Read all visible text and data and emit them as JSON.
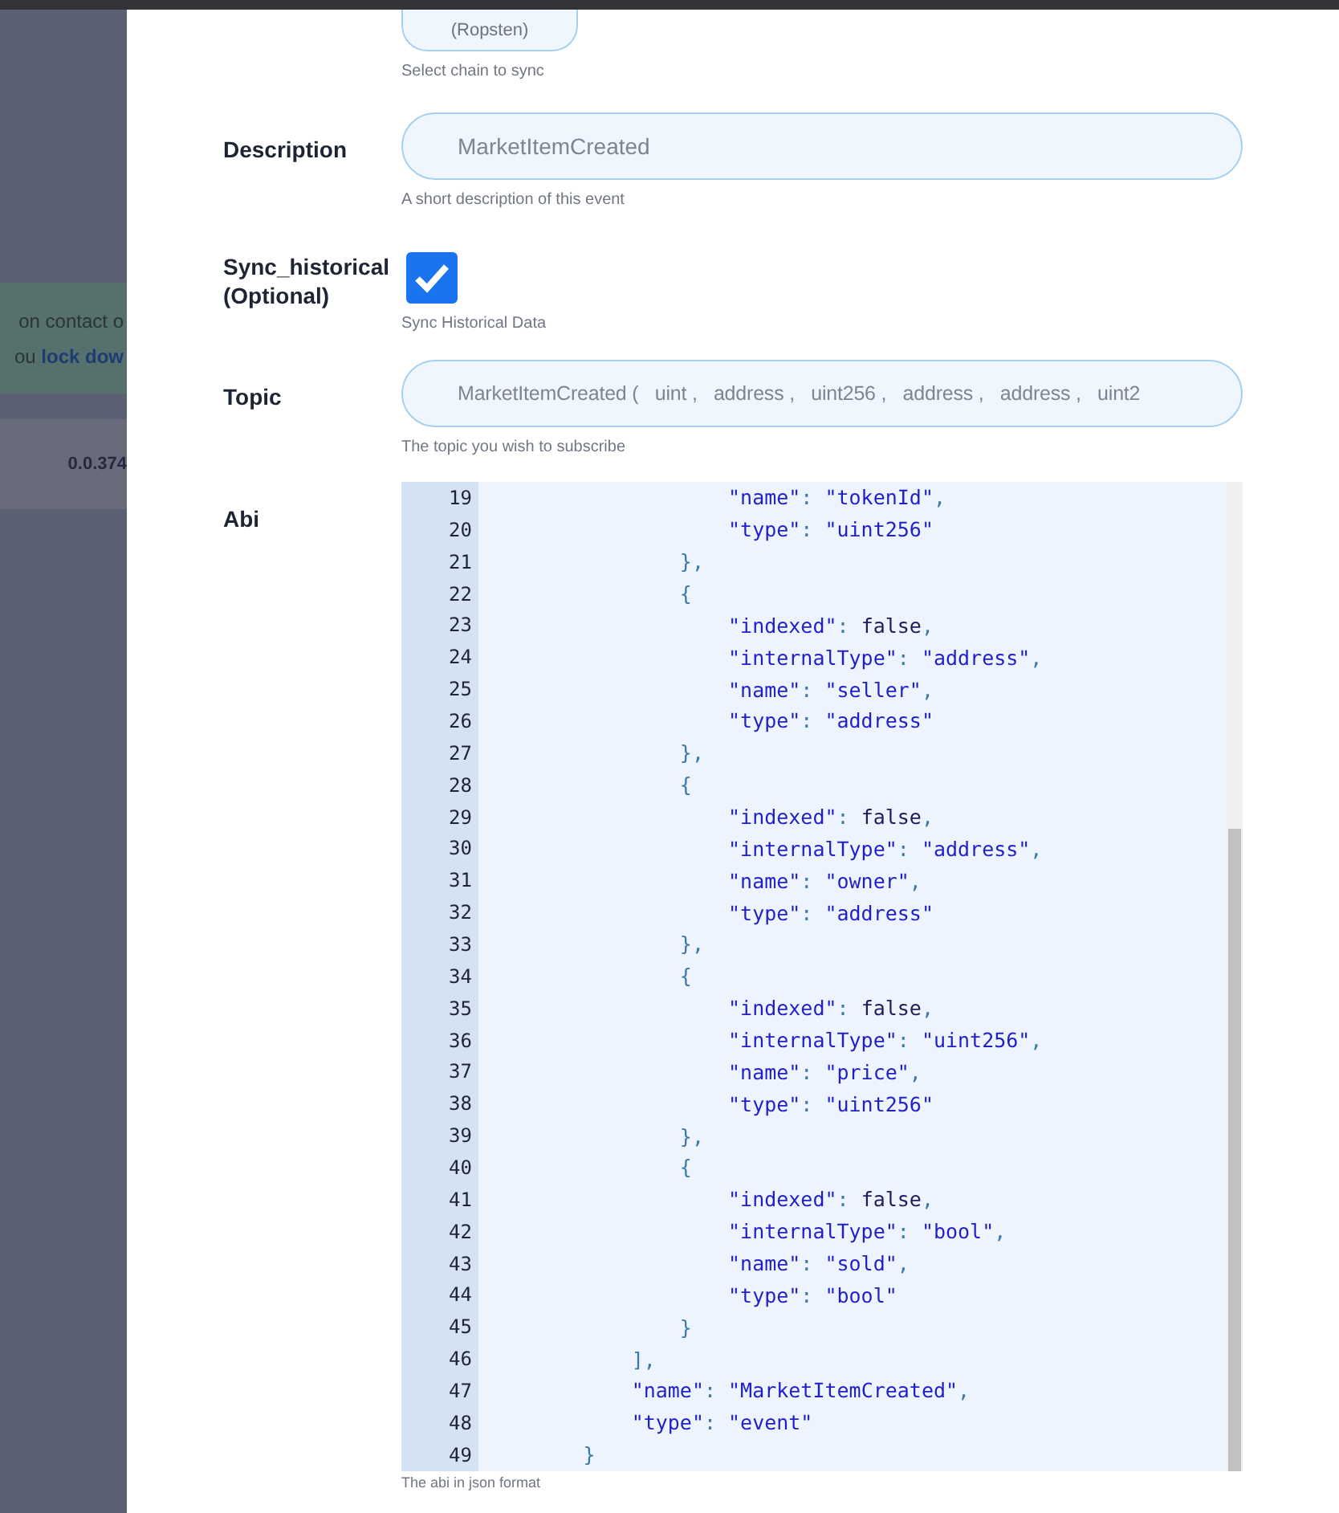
{
  "background_page": {
    "notice_lines": [
      "on contact o"
    ],
    "notice_prefix": "ou",
    "notice_link": "lock dow",
    "version": "0.0.374"
  },
  "form": {
    "chain": {
      "value": "(Ropsten)",
      "help": "Select chain to sync"
    },
    "description": {
      "label": "Description",
      "value": "MarketItemCreated",
      "help": "A short description of this event"
    },
    "sync_historical": {
      "label": "Sync_historical (Optional)",
      "checked": true,
      "help": "Sync Historical Data"
    },
    "topic": {
      "label": "Topic",
      "value": "MarketItemCreated (   uint ,   address ,   uint256 ,   address ,   address ,   uint2",
      "help": "The topic you wish to subscribe"
    },
    "abi": {
      "label": "Abi",
      "help": "The abi in json format",
      "lines": [
        {
          "n": "19",
          "text": "                    \"name\": \"tokenId\","
        },
        {
          "n": "20",
          "text": "                    \"type\": \"uint256\""
        },
        {
          "n": "21",
          "text": "                },"
        },
        {
          "n": "22",
          "text": "                {"
        },
        {
          "n": "23",
          "text": "                    \"indexed\": false,"
        },
        {
          "n": "24",
          "text": "                    \"internalType\": \"address\","
        },
        {
          "n": "25",
          "text": "                    \"name\": \"seller\","
        },
        {
          "n": "26",
          "text": "                    \"type\": \"address\""
        },
        {
          "n": "27",
          "text": "                },"
        },
        {
          "n": "28",
          "text": "                {"
        },
        {
          "n": "29",
          "text": "                    \"indexed\": false,"
        },
        {
          "n": "30",
          "text": "                    \"internalType\": \"address\","
        },
        {
          "n": "31",
          "text": "                    \"name\": \"owner\","
        },
        {
          "n": "32",
          "text": "                    \"type\": \"address\""
        },
        {
          "n": "33",
          "text": "                },"
        },
        {
          "n": "34",
          "text": "                {"
        },
        {
          "n": "35",
          "text": "                    \"indexed\": false,"
        },
        {
          "n": "36",
          "text": "                    \"internalType\": \"uint256\","
        },
        {
          "n": "37",
          "text": "                    \"name\": \"price\","
        },
        {
          "n": "38",
          "text": "                    \"type\": \"uint256\""
        },
        {
          "n": "39",
          "text": "                },"
        },
        {
          "n": "40",
          "text": "                {"
        },
        {
          "n": "41",
          "text": "                    \"indexed\": false,"
        },
        {
          "n": "42",
          "text": "                    \"internalType\": \"bool\","
        },
        {
          "n": "43",
          "text": "                    \"name\": \"sold\","
        },
        {
          "n": "44",
          "text": "                    \"type\": \"bool\""
        },
        {
          "n": "45",
          "text": "                }"
        },
        {
          "n": "46",
          "text": "            ],"
        },
        {
          "n": "47",
          "text": "            \"name\": \"MarketItemCreated\","
        },
        {
          "n": "48",
          "text": "            \"type\": \"event\""
        },
        {
          "n": "49",
          "text": "        }"
        }
      ]
    }
  }
}
